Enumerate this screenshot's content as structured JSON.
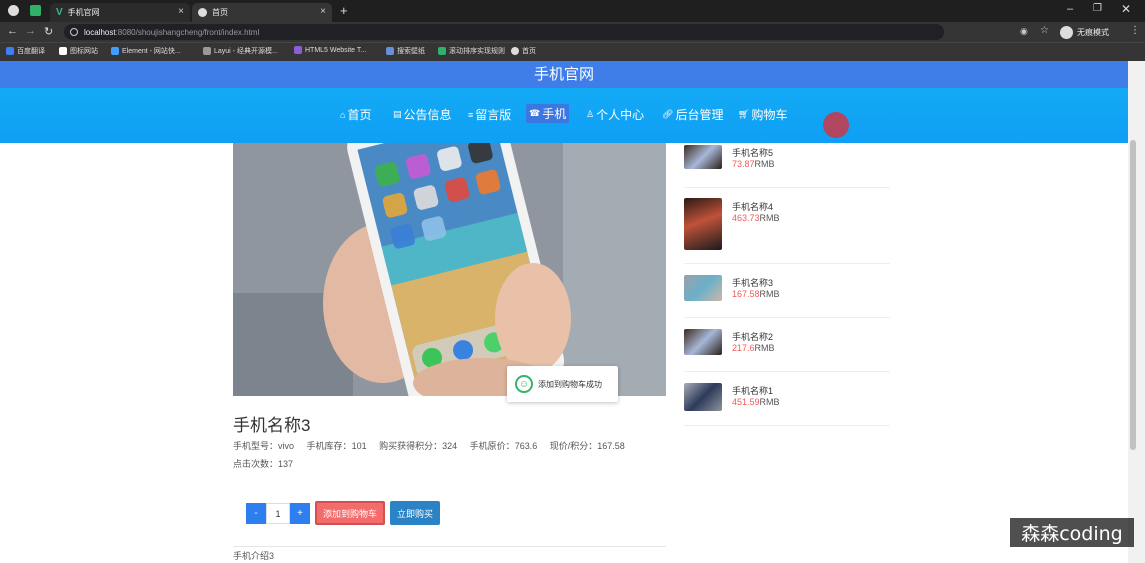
{
  "browser": {
    "tabs": [
      {
        "title": "手机官网",
        "active": false
      },
      {
        "title": "首页",
        "active": true
      }
    ],
    "url_host": "localhost",
    "url_path": ":8080/shoujishangcheng/front/index.html",
    "profile": "无痕模式",
    "new_tab": "+",
    "bookmarks": [
      "百度翻译",
      "图标网站",
      "Element - 网站快...",
      "Layui - 经典开源模...",
      "HTML5 Website T...",
      "搜索壁纸",
      "滚动排序实现规则",
      "首页"
    ]
  },
  "site": {
    "title": "手机官网",
    "nav": [
      "首页",
      "公告信息",
      "留言版",
      "手机",
      "个人中心",
      "后台管理",
      "购物车"
    ],
    "active_nav": "手机"
  },
  "product": {
    "name": "手机名称3",
    "model_label": "手机型号：",
    "model": "vivo",
    "stock_label": "手机库存：",
    "stock": "101",
    "points_label": "购买获得积分：",
    "points": "324",
    "orig_price_label": "手机原价：",
    "orig_price": "763.6",
    "cur_price_label": "现价/积分：",
    "cur_price": "167.58",
    "clicks_label": "点击次数：",
    "clicks": "137",
    "quantity": "1",
    "minus": "-",
    "plus": "+",
    "add_cart": "添加到购物车",
    "buy_now": "立即购买",
    "intro": "手机介绍3"
  },
  "toast": {
    "text": "添加到购物车成功"
  },
  "sidebar": {
    "items": [
      {
        "name": "手机名称5",
        "price": "73.87",
        "unit": "RMB"
      },
      {
        "name": "手机名称4",
        "price": "463.73",
        "unit": "RMB"
      },
      {
        "name": "手机名称3",
        "price": "167.58",
        "unit": "RMB"
      },
      {
        "name": "手机名称2",
        "price": "217.6",
        "unit": "RMB"
      },
      {
        "name": "手机名称1",
        "price": "451.59",
        "unit": "RMB"
      }
    ]
  },
  "watermark": "森森coding"
}
